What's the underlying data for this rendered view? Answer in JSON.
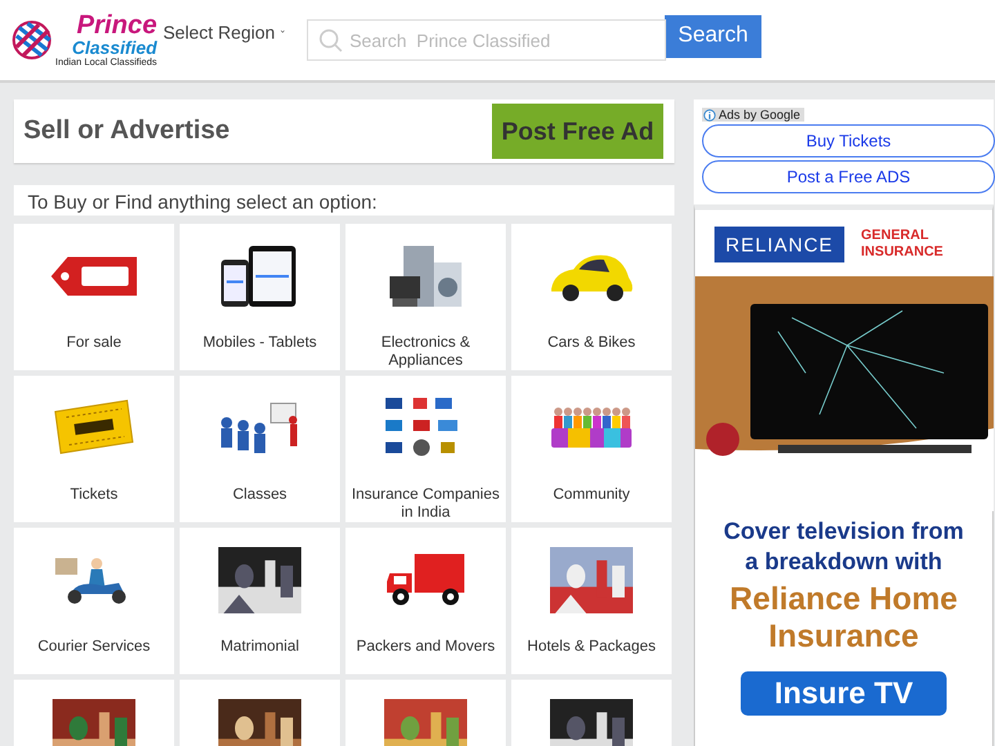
{
  "header": {
    "logo": {
      "name": "Prince",
      "sub": "Classified",
      "tagline": "Indian Local Classifieds"
    },
    "region": "Select Region",
    "search": {
      "placeholder": "Search  Prince Classified",
      "button": "Search"
    }
  },
  "promo": {
    "title": "Sell or Advertise",
    "button": "Post Free Ad"
  },
  "categories": {
    "heading": "To Buy or Find anything select an option:",
    "items": [
      {
        "label": "For sale"
      },
      {
        "label": "Mobiles - Tablets"
      },
      {
        "label": "Electronics & Appliances"
      },
      {
        "label": "Cars & Bikes"
      },
      {
        "label": "Tickets"
      },
      {
        "label": "Classes"
      },
      {
        "label": "Insurance Companies in India"
      },
      {
        "label": "Community"
      },
      {
        "label": "Courier Services"
      },
      {
        "label": "Matrimonial",
        "kind": "picture"
      },
      {
        "label": "Packers and Movers"
      },
      {
        "label": "Hotels & Packages",
        "kind": "picture"
      },
      {
        "kind": "picture"
      },
      {
        "kind": "picture"
      },
      {
        "kind": "picture"
      },
      {
        "kind": "picture"
      }
    ]
  },
  "sidebar": {
    "ads_label": "Ads by Google",
    "links": [
      "Buy Tickets",
      "Post a Free ADS"
    ],
    "ad": {
      "brand": "RELIANCE",
      "brand_sub": "GENERAL INSURANCE",
      "headline": "Cover television from a breakdown with",
      "product": "Reliance Home Insurance",
      "cta": "Insure TV"
    }
  }
}
